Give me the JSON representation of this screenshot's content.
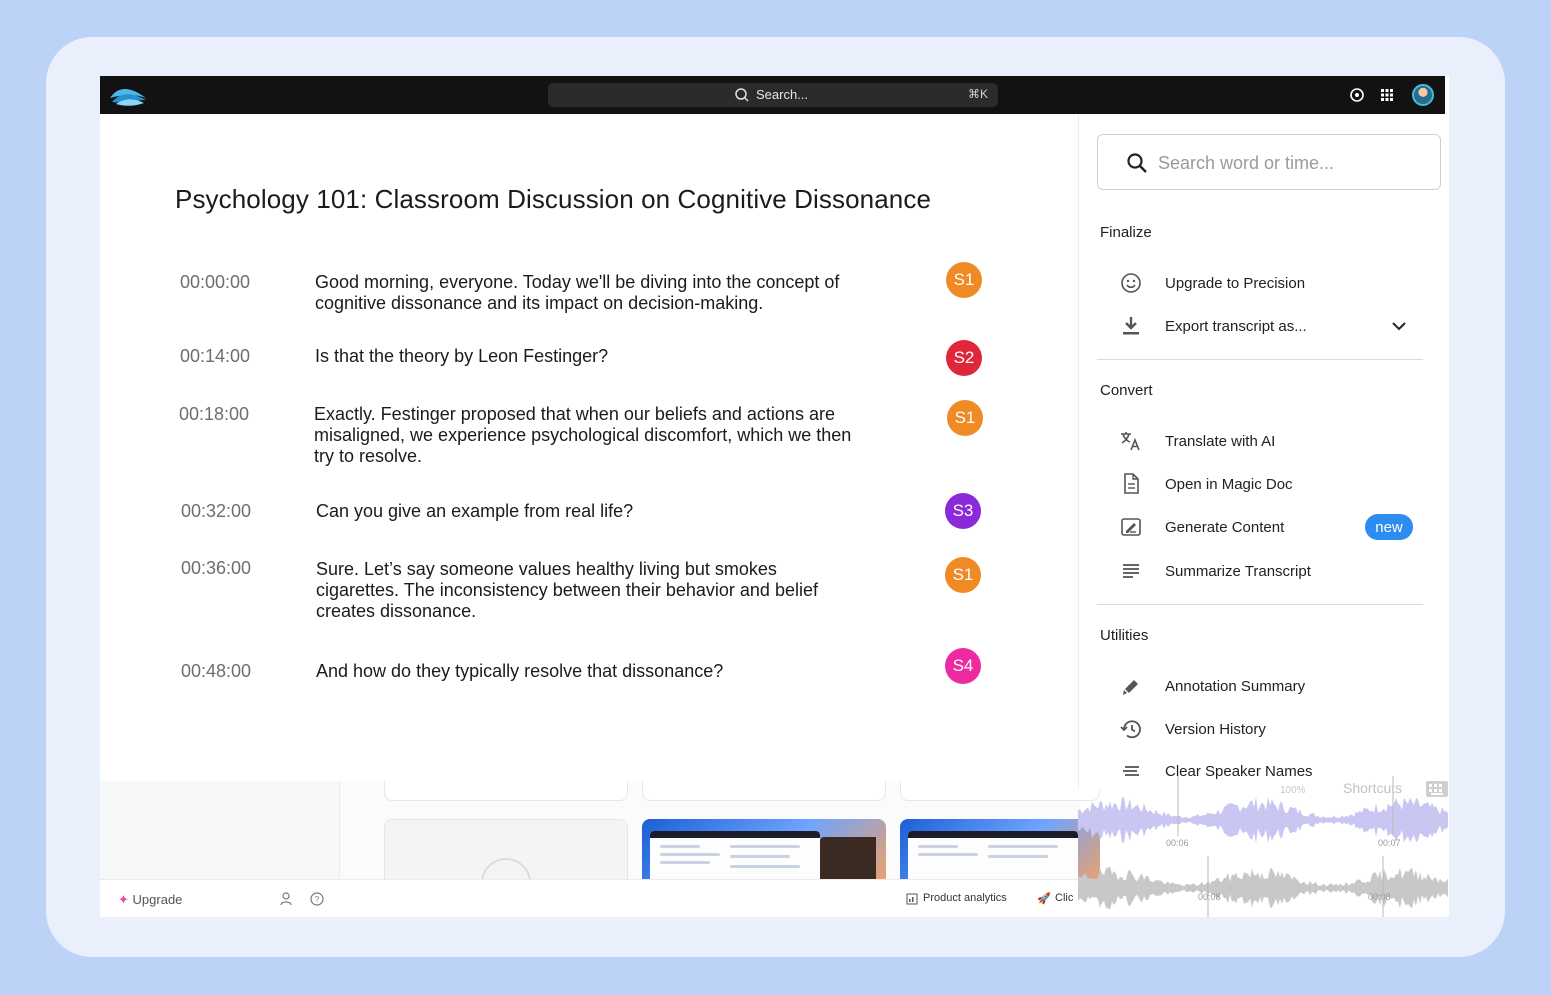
{
  "topbar": {
    "search_placeholder": "Search...",
    "search_shortcut": "⌘K"
  },
  "transcript": {
    "title": "Psychology 101: Classroom Discussion on Cognitive Dissonance",
    "rows": [
      {
        "time": "00:00:00",
        "text": "Good morning, everyone. Today we'll be diving into the concept of cognitive dissonance and its impact on decision-making.",
        "speaker": "S1",
        "color": "#ef8a25"
      },
      {
        "time": "00:14:00",
        "text": "Is that the theory by Leon Festinger?",
        "speaker": "S2",
        "color": "#e0263a"
      },
      {
        "time": "00:18:00",
        "text": "Exactly. Festinger proposed that when our beliefs and actions are misaligned, we experience psychological discomfort, which we then try to resolve.",
        "speaker": "S1",
        "color": "#ef8a25"
      },
      {
        "time": "00:32:00",
        "text": "Can you give an example from real life?",
        "speaker": "S3",
        "color": "#8a2ad8"
      },
      {
        "time": "00:36:00",
        "text": "Sure. Let’s say someone values healthy living but smokes cigarettes. The inconsistency between their behavior and belief creates dissonance.",
        "speaker": "S1",
        "color": "#ef8a25"
      },
      {
        "time": "00:48:00",
        "text": "And how do they typically resolve that dissonance?",
        "speaker": "S4",
        "color": "#ee2aa0"
      }
    ]
  },
  "panel": {
    "search_placeholder": "Search word or time...",
    "finalize": {
      "heading": "Finalize",
      "items": [
        {
          "label": "Upgrade to Precision",
          "icon": "smiley-icon"
        },
        {
          "label": "Export transcript as...",
          "icon": "download-icon"
        }
      ]
    },
    "convert": {
      "heading": "Convert",
      "items": [
        {
          "label": "Translate with AI",
          "icon": "translate-icon"
        },
        {
          "label": "Open in Magic Doc",
          "icon": "document-icon"
        },
        {
          "label": "Generate Content",
          "icon": "generate-icon",
          "badge": "new"
        },
        {
          "label": "Summarize Transcript",
          "icon": "lines-icon"
        }
      ]
    },
    "utilities": {
      "heading": "Utilities",
      "items": [
        {
          "label": "Annotation Summary",
          "icon": "highlighter-icon"
        },
        {
          "label": "Version History",
          "icon": "history-icon"
        },
        {
          "label": "Clear Speaker Names",
          "icon": "clear-lines-icon"
        }
      ]
    }
  },
  "waveform": {
    "shortcuts": "Shortcuts",
    "zoom": "100%",
    "ticks": [
      "00:06",
      "00:07",
      "00:08",
      "00:08"
    ]
  },
  "background": {
    "upgrade": "Upgrade",
    "product_analytics": "Product analytics",
    "clip": "Clic"
  },
  "colors": {
    "accent": "#2d8cf0",
    "page_bg": "#bcd2f7",
    "waveform_primary": "#c9c6f2",
    "waveform_secondary": "#c8c8c8"
  }
}
